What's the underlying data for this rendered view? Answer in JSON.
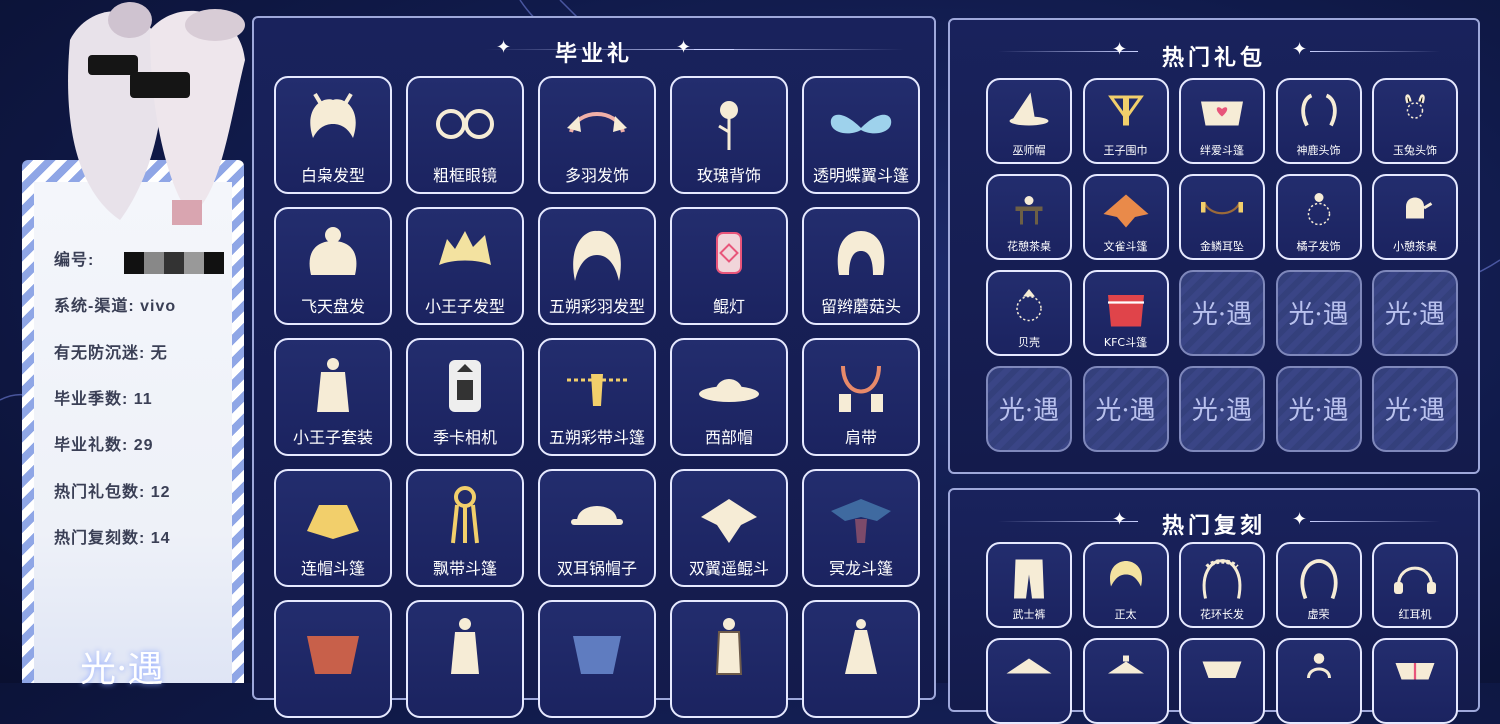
{
  "player": {
    "id_label": "编号:",
    "system_label": "系统-渠道: vivo",
    "anti_addiction": "有无防沉迷: 无",
    "grad_seasons": "毕业季数: 11",
    "grad_gifts": "毕业礼数: 29",
    "hot_packs": "热门礼包数: 12",
    "hot_reruns": "热门复刻数: 14",
    "logo": "光·遇"
  },
  "graduation": {
    "title": "毕业礼",
    "items": [
      {
        "label": "白枭发型",
        "icon": "hair-icon"
      },
      {
        "label": "粗框眼镜",
        "icon": "glasses-icon"
      },
      {
        "label": "多羽发饰",
        "icon": "feather-headband-icon"
      },
      {
        "label": "玫瑰背饰",
        "icon": "rose-icon"
      },
      {
        "label": "透明蝶翼斗篷",
        "icon": "butterfly-cape-icon"
      },
      {
        "label": "飞天盘发",
        "icon": "bun-hair-icon"
      },
      {
        "label": "小王子发型",
        "icon": "spiky-hair-icon"
      },
      {
        "label": "五朔彩羽发型",
        "icon": "long-hair-icon"
      },
      {
        "label": "鲲灯",
        "icon": "lantern-icon"
      },
      {
        "label": "留辫蘑菇头",
        "icon": "bob-hair-icon"
      },
      {
        "label": "小王子套装",
        "icon": "outfit-icon"
      },
      {
        "label": "季卡相机",
        "icon": "camera-icon"
      },
      {
        "label": "五朔彩带斗篷",
        "icon": "ribbon-cape-icon"
      },
      {
        "label": "西部帽",
        "icon": "cowboy-hat-icon"
      },
      {
        "label": "肩带",
        "icon": "shoulder-strap-icon"
      },
      {
        "label": "连帽斗篷",
        "icon": "hood-cape-icon"
      },
      {
        "label": "飘带斗篷",
        "icon": "streamer-cape-icon"
      },
      {
        "label": "双耳锅帽子",
        "icon": "pot-hat-icon"
      },
      {
        "label": "双翼遥鲲斗",
        "icon": "wing-cape-icon"
      },
      {
        "label": "冥龙斗篷",
        "icon": "dragon-cape-icon"
      },
      {
        "label": "",
        "icon": "red-cape-icon"
      },
      {
        "label": "",
        "icon": "white-outfit-icon"
      },
      {
        "label": "",
        "icon": "blue-cape-icon"
      },
      {
        "label": "",
        "icon": "armor-outfit-icon"
      },
      {
        "label": "",
        "icon": "dress-icon"
      }
    ]
  },
  "hot_packs": {
    "title": "热门礼包",
    "items": [
      {
        "label": "巫师帽",
        "icon": "witch-hat-icon"
      },
      {
        "label": "王子围巾",
        "icon": "scarf-icon"
      },
      {
        "label": "绊爱斗篷",
        "icon": "heart-cape-icon"
      },
      {
        "label": "神鹿头饰",
        "icon": "antlers-icon"
      },
      {
        "label": "玉兔头饰",
        "icon": "rabbit-icon"
      },
      {
        "label": "花憩茶桌",
        "icon": "tea-table-icon"
      },
      {
        "label": "文雀斗篷",
        "icon": "sparrow-cape-icon"
      },
      {
        "label": "金鳞耳坠",
        "icon": "earring-icon"
      },
      {
        "label": "橘子发饰",
        "icon": "orange-hair-icon"
      },
      {
        "label": "小憩茶桌",
        "icon": "teapot-icon"
      },
      {
        "label": "贝壳",
        "icon": "shell-icon"
      },
      {
        "label": "KFC斗篷",
        "icon": "kfc-cape-icon"
      }
    ],
    "empty_label": "光·遇"
  },
  "hot_reruns": {
    "title": "热门复刻",
    "items": [
      {
        "label": "武士裤",
        "icon": "pants-icon"
      },
      {
        "label": "正太",
        "icon": "short-hair-icon"
      },
      {
        "label": "花环长发",
        "icon": "wreath-hair-icon"
      },
      {
        "label": "虚荣",
        "icon": "curly-hair-icon"
      },
      {
        "label": "红耳机",
        "icon": "headphones-icon"
      },
      {
        "label": "",
        "icon": "straw-hat-icon"
      },
      {
        "label": "",
        "icon": "bamboo-hat-icon"
      },
      {
        "label": "",
        "icon": "cape-icon"
      },
      {
        "label": "",
        "icon": "hair-bun-icon"
      },
      {
        "label": "",
        "icon": "mask-icon"
      }
    ]
  },
  "colors": {
    "accent": "#9ea8da",
    "bg": "#141b4c",
    "tile": "#232d6e",
    "gold": "#f2cf6b"
  }
}
